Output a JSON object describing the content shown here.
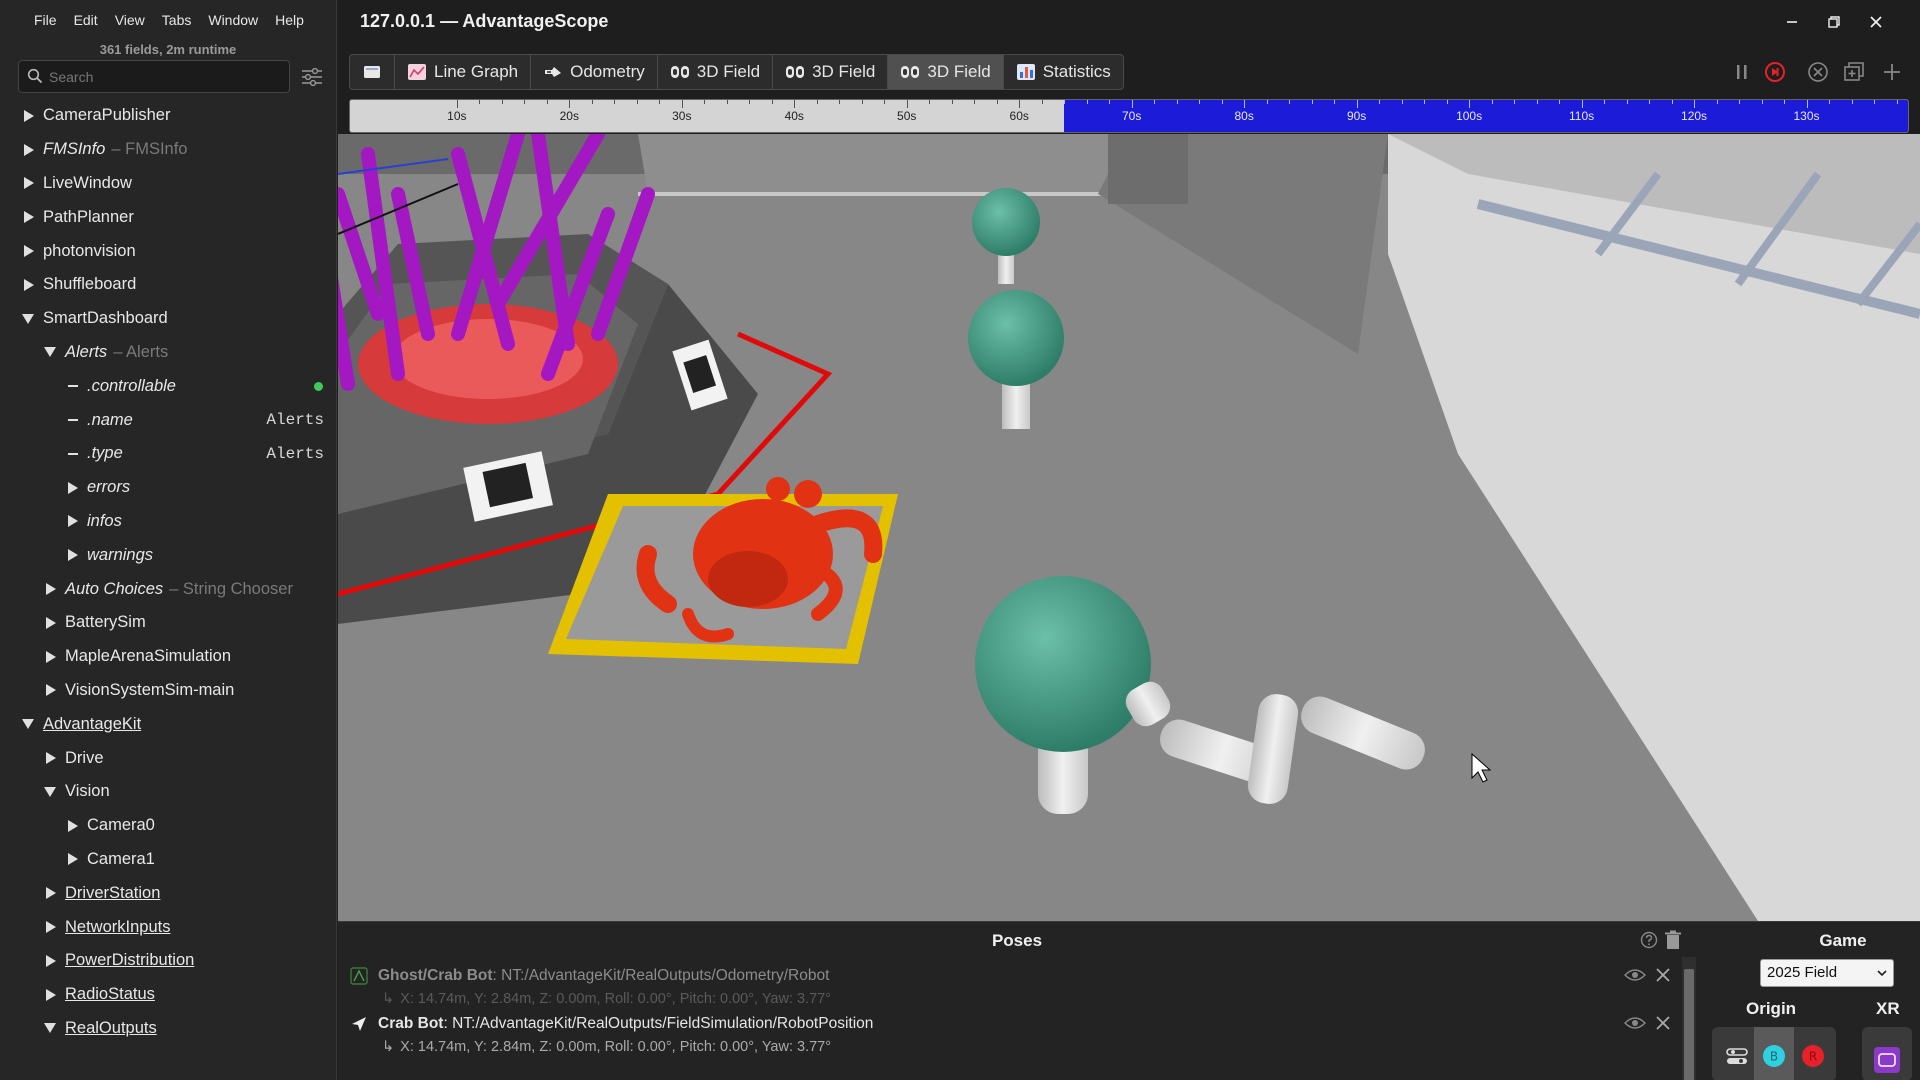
{
  "window": {
    "title": "127.0.0.1 — AdvantageScope"
  },
  "menu": [
    "File",
    "Edit",
    "View",
    "Tabs",
    "Window",
    "Help"
  ],
  "sidebar": {
    "runtime_info": "361 fields, 2m runtime",
    "search_placeholder": "Search",
    "tree": [
      {
        "label": "CameraPublisher",
        "state": "collapsed",
        "depth": 0
      },
      {
        "label": "FMSInfo",
        "type": "FMSInfo",
        "state": "collapsed",
        "depth": 0,
        "italic": true
      },
      {
        "label": "LiveWindow",
        "state": "collapsed",
        "depth": 0
      },
      {
        "label": "PathPlanner",
        "state": "collapsed",
        "depth": 0
      },
      {
        "label": "photonvision",
        "state": "collapsed",
        "depth": 0
      },
      {
        "label": "Shuffleboard",
        "state": "collapsed",
        "depth": 0
      },
      {
        "label": "SmartDashboard",
        "state": "expanded",
        "depth": 0
      },
      {
        "label": "Alerts",
        "type": "Alerts",
        "state": "expanded",
        "depth": 1,
        "italic": true
      },
      {
        "label": ".controllable",
        "state": "leaf",
        "depth": 2,
        "italic": true,
        "indicator": "green"
      },
      {
        "label": ".name",
        "state": "leaf",
        "depth": 2,
        "italic": true,
        "value": "Alerts"
      },
      {
        "label": ".type",
        "state": "leaf",
        "depth": 2,
        "italic": true,
        "value": "Alerts"
      },
      {
        "label": "errors",
        "state": "collapsed",
        "depth": 2,
        "italic": true
      },
      {
        "label": "infos",
        "state": "collapsed",
        "depth": 2,
        "italic": true
      },
      {
        "label": "warnings",
        "state": "collapsed",
        "depth": 2,
        "italic": true
      },
      {
        "label": "Auto Choices",
        "type": "String Chooser",
        "state": "collapsed",
        "depth": 1,
        "italic": true
      },
      {
        "label": "BatterySim",
        "state": "collapsed",
        "depth": 1
      },
      {
        "label": "MapleArenaSimulation",
        "state": "collapsed",
        "depth": 1
      },
      {
        "label": "VisionSystemSim-main",
        "state": "collapsed",
        "depth": 1
      },
      {
        "label": "AdvantageKit",
        "state": "expanded",
        "depth": 0,
        "underline": true
      },
      {
        "label": "Drive",
        "state": "collapsed",
        "depth": 1
      },
      {
        "label": "Vision",
        "state": "expanded",
        "depth": 1
      },
      {
        "label": "Camera0",
        "state": "collapsed",
        "depth": 2
      },
      {
        "label": "Camera1",
        "state": "collapsed",
        "depth": 2
      },
      {
        "label": "DriverStation",
        "state": "collapsed",
        "depth": 1,
        "underline": true
      },
      {
        "label": "NetworkInputs",
        "state": "collapsed",
        "depth": 1,
        "underline": true
      },
      {
        "label": "PowerDistribution",
        "state": "collapsed",
        "depth": 1,
        "underline": true
      },
      {
        "label": "RadioStatus",
        "state": "collapsed",
        "depth": 1,
        "underline": true
      },
      {
        "label": "RealOutputs",
        "state": "expanded",
        "depth": 1,
        "underline": true
      }
    ]
  },
  "tabs": [
    {
      "label": "",
      "icon": "document-icon",
      "active": false
    },
    {
      "label": "Line Graph",
      "icon": "line-graph-icon",
      "active": false
    },
    {
      "label": "Odometry",
      "icon": "odometry-icon",
      "active": false
    },
    {
      "label": "3D Field",
      "icon": "3d-field-icon",
      "active": false
    },
    {
      "label": "3D Field",
      "icon": "3d-field-icon",
      "active": false
    },
    {
      "label": "3D Field",
      "icon": "3d-field-icon",
      "active": true
    },
    {
      "label": "Statistics",
      "icon": "statistics-icon",
      "active": false
    }
  ],
  "timeline": {
    "labels": [
      "10s",
      "20s",
      "30s",
      "40s",
      "50s",
      "60s",
      "70s",
      "80s",
      "90s",
      "100s",
      "110s",
      "120s",
      "130s"
    ],
    "range_seconds": [
      0.5,
      139.2
    ],
    "enabled_from_seconds": 64,
    "enabled_color": "#1b1bd8"
  },
  "poses": {
    "title": "Poses",
    "items": [
      {
        "kind": "Ghost/Crab Bot",
        "source": "NT:/AdvantageKit/RealOutputs/Odometry/Robot",
        "detail": "X: 14.74m, Y: 2.84m, Z: 0.00m, Roll: 0.00°, Pitch: 0.00°, Yaw: 3.77°",
        "ghost": true
      },
      {
        "kind": "Crab Bot",
        "source": "NT:/AdvantageKit/RealOutputs/FieldSimulation/RobotPosition",
        "detail": "X: 14.74m, Y: 2.84m, Z: 0.00m, Roll: 0.00°, Pitch: 0.00°, Yaw: 3.77°",
        "ghost": false
      }
    ]
  },
  "game": {
    "label": "Game",
    "selected": "2025 Field",
    "origin_label": "Origin",
    "xr_label": "XR"
  },
  "colors": {
    "blue_alliance": "#2fd1e0",
    "red_alliance": "#e8202a",
    "active_tab": "#505050"
  }
}
